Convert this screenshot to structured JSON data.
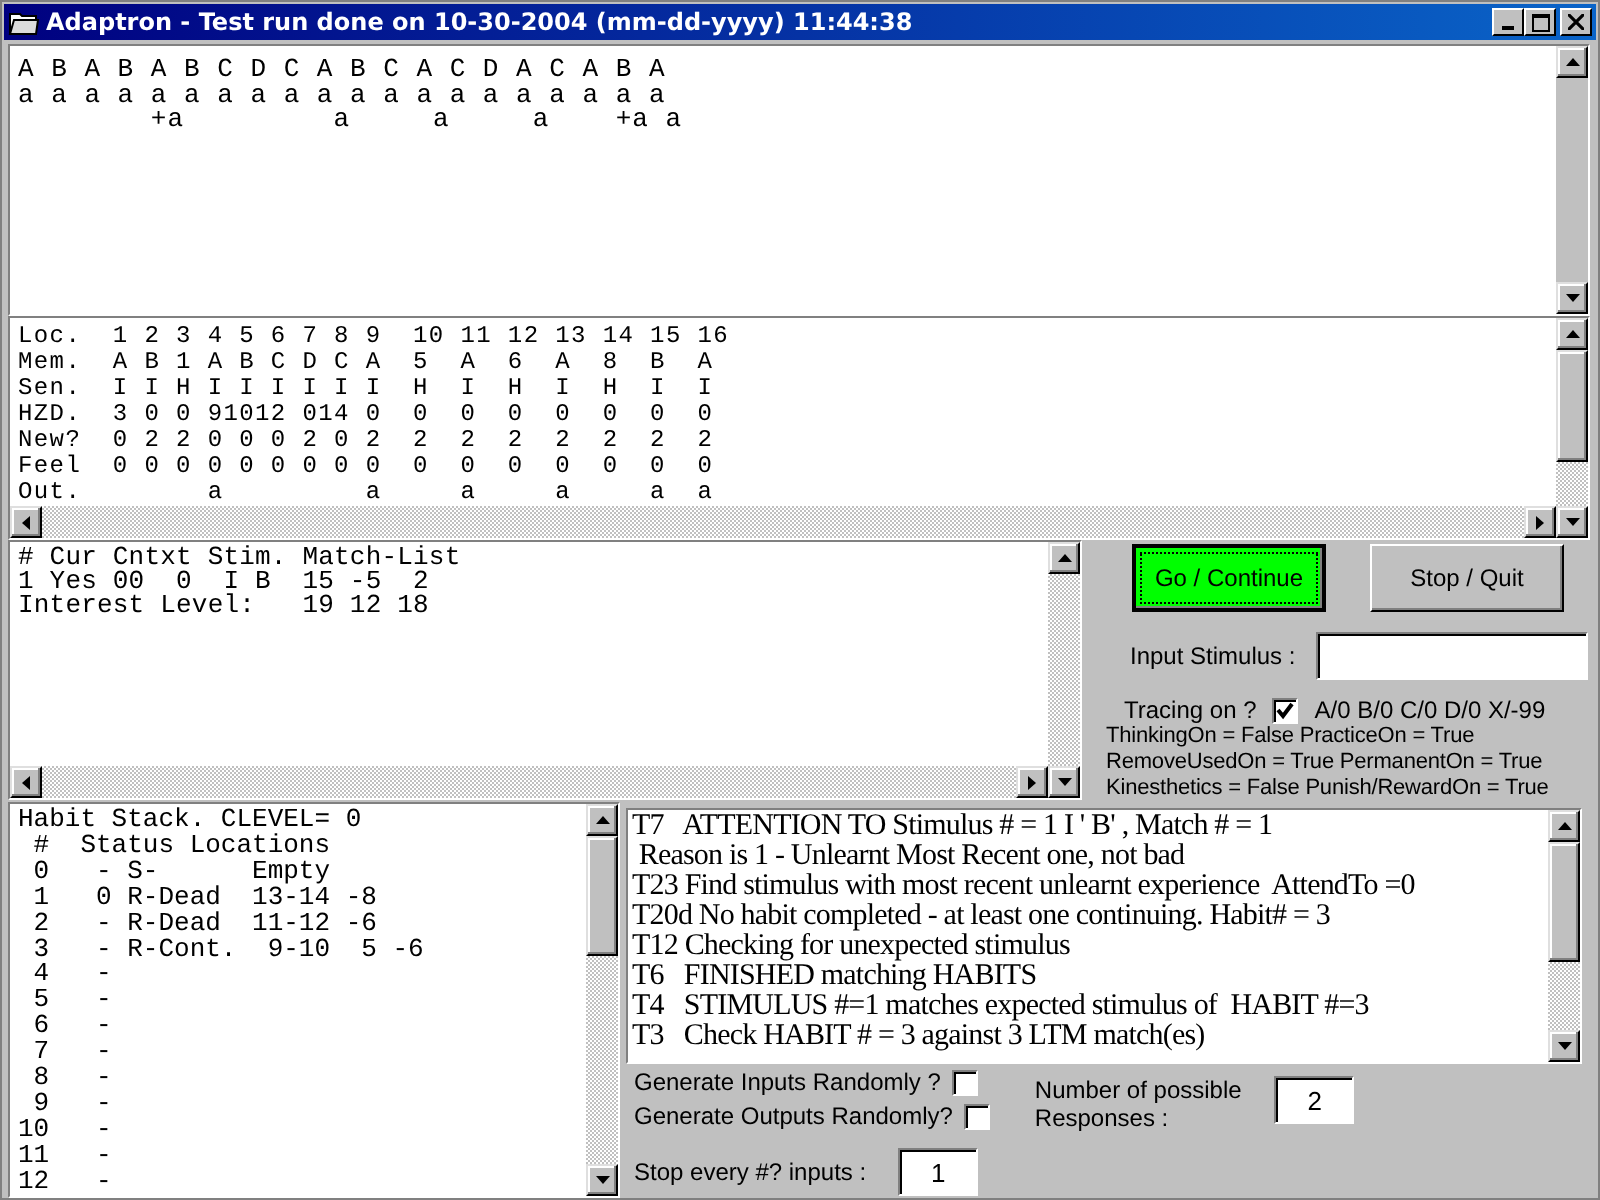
{
  "window": {
    "title": "Adaptron - Test run done on 10-30-2004 (mm-dd-yyyy) 11:44:38"
  },
  "sequence_pane": {
    "lines": [
      "A B A B A B C D C A B C A C D A C A B A",
      "a a a a a a a a a a a a a a a a a a a a",
      "        +a         a     a     a    +a a"
    ]
  },
  "memory_table": {
    "lines": [
      "Loc.  1 2 3 4 5 6 7 8 9  10 11 12 13 14 15 16",
      "Mem.  A B 1 A B C D C A  5  A  6  A  8  B  A",
      "Sen.  I I H I I I I I I  H  I  H  I  H  I  I",
      "HZD.  3 0 0 91012 014 0  0  0  0  0  0  0  0",
      "New?  0 2 2 0 0 0 2 0 2  2  2  2  2  2  2  2",
      "Feel  0 0 0 0 0 0 0 0 0  0  0  0  0  0  0  0",
      "Out.        a         a     a     a     a  a"
    ]
  },
  "match_pane": {
    "lines": [
      "# Cur Cntxt Stim. Match-List",
      "1 Yes 00  0  I B  15 -5  2",
      "Interest Level:   19 12 18"
    ]
  },
  "buttons": [
    {
      "label": "Go / Continue",
      "kind": "primary"
    },
    {
      "label": "Stop / Quit",
      "kind": "normal"
    }
  ],
  "input_stimulus": {
    "label": "Input Stimulus :"
  },
  "tracing": {
    "label": "Tracing on ?",
    "checked": true,
    "legend": "A/0 B/0 C/0 D/0 X/-99"
  },
  "settings_lines": [
    "ThinkingOn = False PracticeOn = True",
    "RemoveUsedOn = True PermanentOn = True",
    "Kinesthetics = False Punish/RewardOn = True"
  ],
  "habit_stack": {
    "lines": [
      "Habit Stack. CLEVEL= 0",
      " #  Status Locations",
      " 0   - S-      Empty",
      " 1   0 R-Dead  13-14 -8",
      " 2   - R-Dead  11-12 -6",
      " 3   - R-Cont.  9-10  5 -6",
      " 4   -",
      " 5   -",
      " 6   -",
      " 7   -",
      " 8   -",
      " 9   -",
      "10   -",
      "11   -",
      "12   -"
    ]
  },
  "trace_log": {
    "lines": [
      "T7   ATTENTION TO Stimulus # = 1 I ' B' , Match # = 1",
      " Reason is 1 - Unlearnt Most Recent one, not bad",
      "T23 Find stimulus with most recent unlearnt experience  AttendTo =0",
      "T20d No habit completed - at least one continuing. Habit# = 3",
      "T12 Checking for unexpected stimulus",
      "T6   FINISHED matching HABITS",
      "T4   STIMULUS #=1 matches expected stimulus of  HABIT #=3",
      "T3   Check HABIT # = 3 against 3 LTM match(es)"
    ]
  },
  "options": [
    {
      "label": "Generate Inputs Randomly ?",
      "checked": false
    },
    {
      "label": "Generate Outputs Randomly?",
      "checked": false
    }
  ],
  "responses": {
    "label": "Number of possible Responses :",
    "value": "2"
  },
  "stop_every": {
    "label": "Stop every #? inputs :",
    "value": "1"
  }
}
